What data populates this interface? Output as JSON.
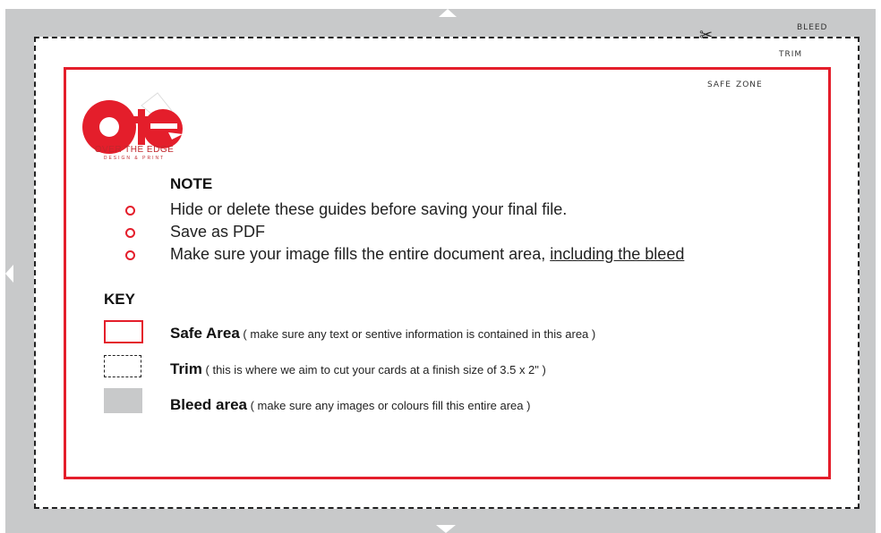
{
  "labels": {
    "bleed": "Bleed",
    "trim": "Trim",
    "safe_zone": "Safe zone"
  },
  "logo": {
    "name": "OVER THE EDGE",
    "tagline": "DESIGN & PRINT"
  },
  "note": {
    "heading": "NOTE",
    "items": [
      "Hide or delete these guides before saving your final  file.",
      "Save as PDF"
    ],
    "item3_prefix": "Make sure your image fills the entire document area, ",
    "item3_underlined": "including the bleed"
  },
  "key": {
    "heading": "KEY",
    "safe": {
      "title": "Safe Area",
      "desc": " ( make sure any text or sentive information is contained in this area )"
    },
    "trim": {
      "title": "Trim",
      "desc": " ( this is where we aim to cut your cards at a finish size of 3.5 x 2\" )"
    },
    "bleed": {
      "title": "Bleed area",
      "desc": " ( make sure any images or colours fill this entire area )"
    }
  },
  "colors": {
    "safe_red": "#e41e2b",
    "bleed_gray": "#c8c9ca",
    "logo_red": "#e41e2b"
  }
}
